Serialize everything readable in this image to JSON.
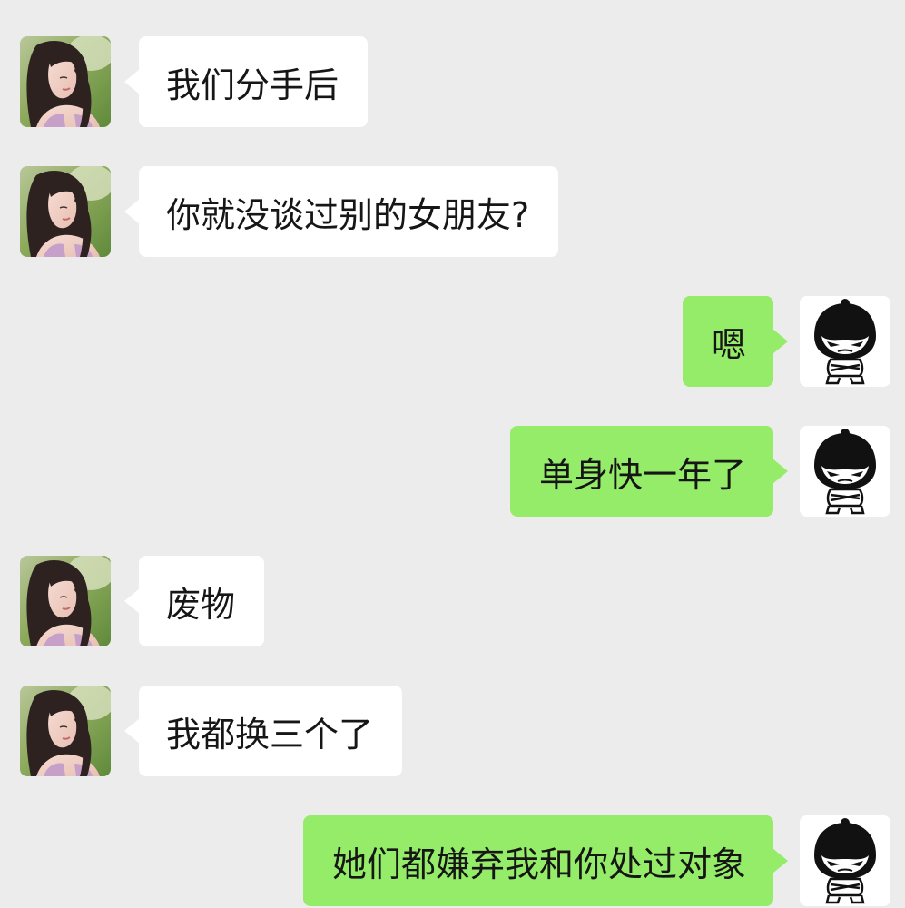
{
  "conversation": {
    "messages": [
      {
        "sender": "contact",
        "text": "我们分手后"
      },
      {
        "sender": "contact",
        "text": "你就没谈过别的女朋友?"
      },
      {
        "sender": "me",
        "text": "嗯"
      },
      {
        "sender": "me",
        "text": "单身快一年了"
      },
      {
        "sender": "contact",
        "text": "废物"
      },
      {
        "sender": "contact",
        "text": "我都换三个了"
      },
      {
        "sender": "me",
        "text": "她们都嫌弃我和你处过对象"
      }
    ]
  },
  "avatars": {
    "contact_icon": "girl-photo-avatar",
    "me_icon": "cartoon-bowl-cut-character-avatar"
  },
  "colors": {
    "background": "#ececec",
    "incoming_bubble": "#ffffff",
    "outgoing_bubble": "#95ec69",
    "text": "#161616"
  }
}
